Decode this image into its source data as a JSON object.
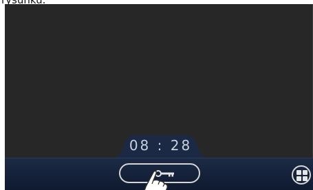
{
  "top_label": "rysunku.",
  "clock": {
    "time": "08 : 28"
  },
  "lock_button": {
    "icon": "key-icon"
  },
  "pointer": {
    "icon": "hand-pointer-icon"
  },
  "apps_button": {
    "icon": "apps-grid-icon"
  },
  "colors": {
    "screen_bg": "#272727",
    "bar_bg": "#14213a",
    "clock_text": "#c9d1de",
    "button_outline": "#d6d6d6"
  }
}
